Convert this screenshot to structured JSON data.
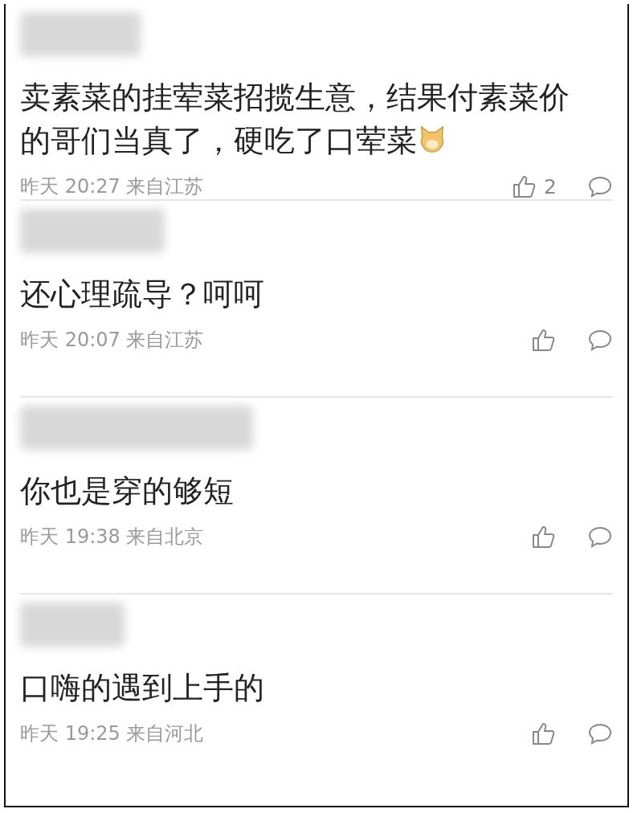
{
  "comments": [
    {
      "text": "卖素菜的挂荤菜招揽生意，结果付素菜价的哥们当真了，硬吃了口荤菜",
      "emoji": true,
      "meta": "昨天 20:27 来自江苏",
      "likes": "2"
    },
    {
      "text": "还心理疏导？呵呵",
      "emoji": false,
      "meta": "昨天 20:07 来自江苏"
    },
    {
      "text": "你也是穿的够短",
      "emoji": false,
      "meta": "昨天 19:38 来自北京"
    },
    {
      "text": "口嗨的遇到上手的",
      "emoji": false,
      "meta": "昨天 19:25 来自河北"
    }
  ]
}
